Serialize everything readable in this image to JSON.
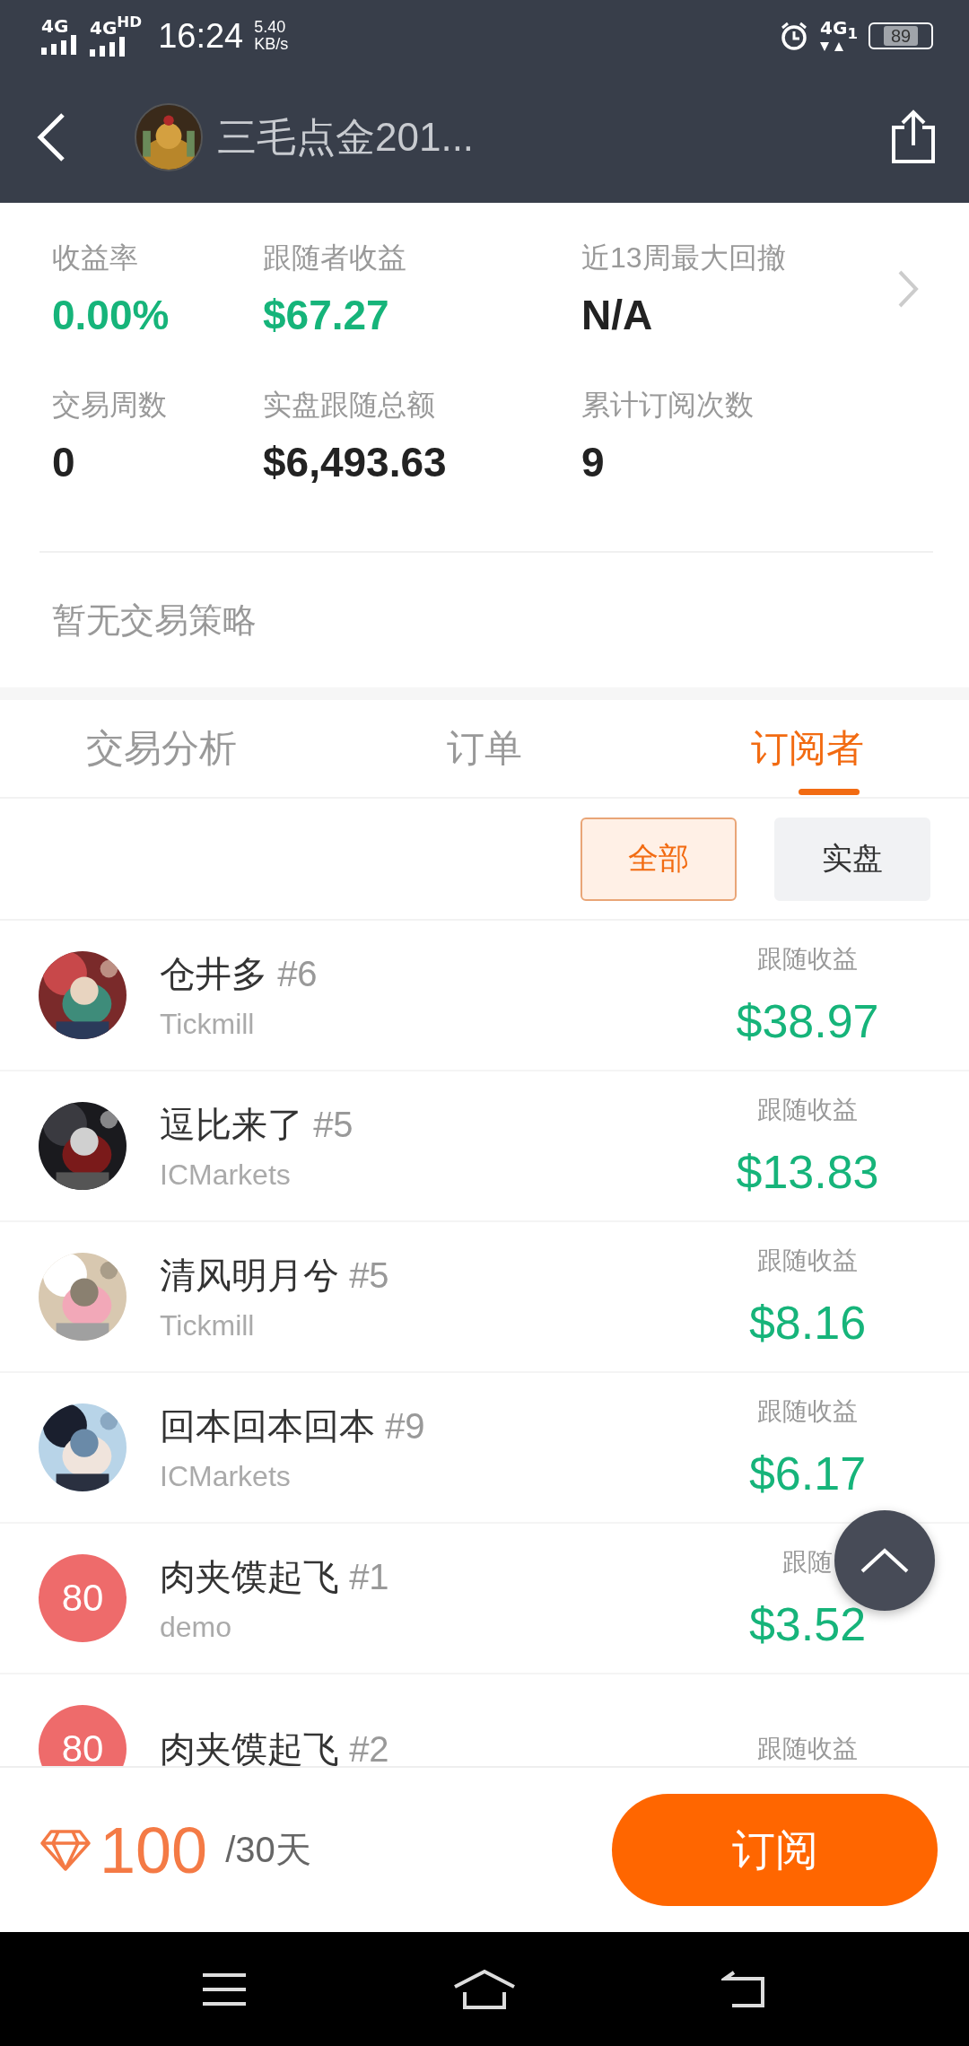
{
  "status_bar": {
    "network_1": "4G",
    "network_2": "4G",
    "network_2_badge": "HD",
    "time": "16:24",
    "speed": "5.40",
    "speed_unit": "KB/s",
    "network_3": "4G",
    "network_3_sim": "1",
    "battery": "89"
  },
  "header": {
    "title": "三毛点金201..."
  },
  "stats": [
    {
      "label": "收益率",
      "value": "0.00%",
      "color": "#16b47a"
    },
    {
      "label": "跟随者收益",
      "value": "$67.27",
      "color": "#16b47a"
    },
    {
      "label": "近13周最大回撤",
      "value": "N/A",
      "color": "#222222"
    },
    {
      "label": "交易周数",
      "value": "0",
      "color": "#222222"
    },
    {
      "label": "实盘跟随总额",
      "value": "$6,493.63",
      "color": "#222222"
    },
    {
      "label": "累计订阅次数",
      "value": "9",
      "color": "#222222"
    }
  ],
  "strategy": "暂无交易策略",
  "tabs": [
    {
      "label": "交易分析",
      "selected": false
    },
    {
      "label": "订单",
      "selected": false
    },
    {
      "label": "订阅者",
      "selected": true
    }
  ],
  "filters": [
    {
      "label": "全部",
      "selected": true
    },
    {
      "label": "实盘",
      "selected": false
    }
  ],
  "subscribers": [
    {
      "name": "仓井多",
      "rank": "#6",
      "broker": "Tickmill",
      "earnings_label": "跟随收益",
      "earnings": "$38.97"
    },
    {
      "name": "逗比来了",
      "rank": "#5",
      "broker": "ICMarkets",
      "earnings_label": "跟随收益",
      "earnings": "$13.83"
    },
    {
      "name": "清风明月兮",
      "rank": "#5",
      "broker": "Tickmill",
      "earnings_label": "跟随收益",
      "earnings": "$8.16"
    },
    {
      "name": "回本回本回本",
      "rank": "#9",
      "broker": "ICMarkets",
      "earnings_label": "跟随收益",
      "earnings": "$6.17"
    },
    {
      "name": "肉夹馍起飞",
      "rank": "#1",
      "broker": "demo",
      "avatar": {
        "kind": "text",
        "text": "80"
      },
      "earnings_label": "跟随",
      "earnings": "$3.52"
    },
    {
      "name": "肉夹馍起飞",
      "rank": "#2",
      "avatar": {
        "kind": "text",
        "text": "80"
      },
      "earnings_label": "跟随收益"
    }
  ],
  "footer": {
    "price": "100",
    "period": "/30天",
    "button": "订阅"
  }
}
